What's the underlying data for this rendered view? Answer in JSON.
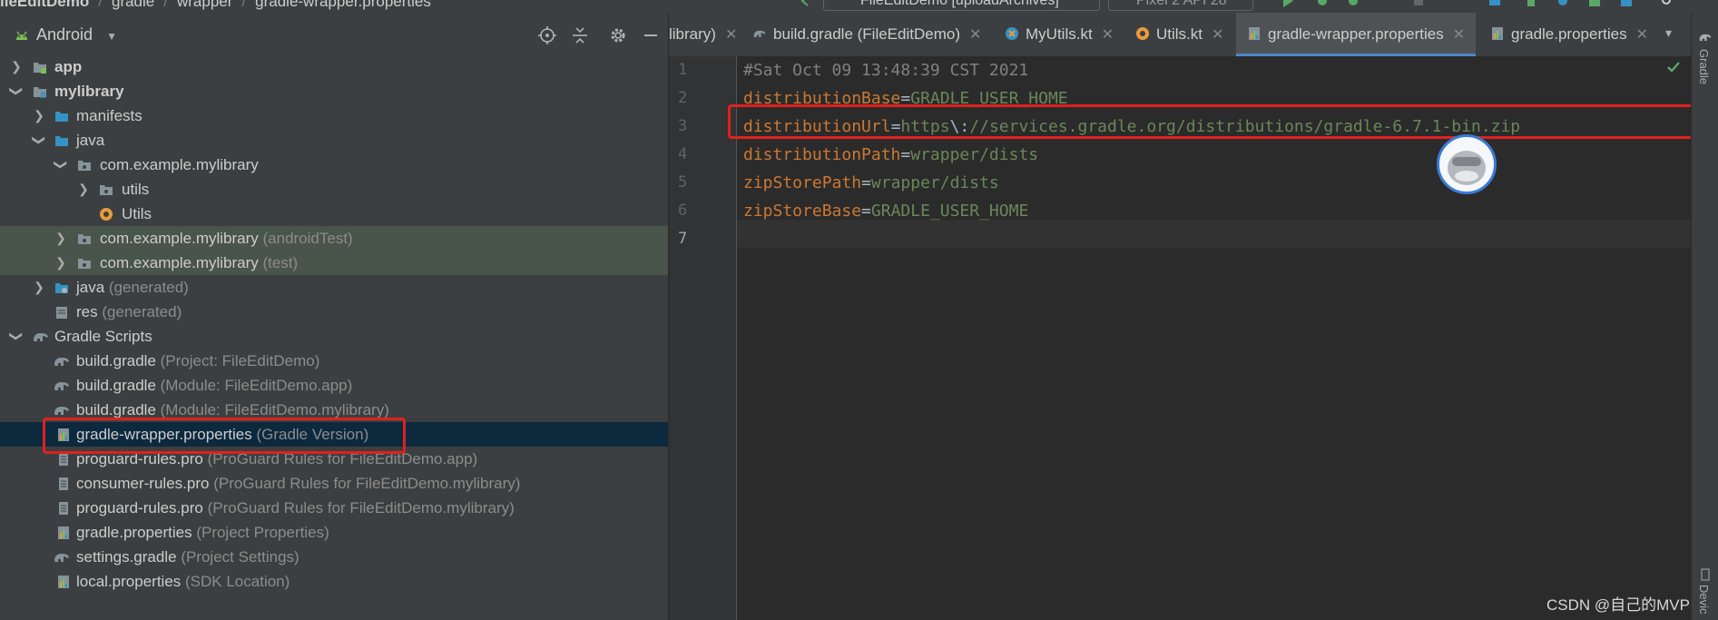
{
  "breadcrumbs": [
    "ileEditDemo",
    "gradle",
    "wrapper",
    "gradle-wrapper.properties"
  ],
  "toolbar": {
    "run_config": "FileEditDemo [uploadArchives]",
    "device": "Pixel 2 API 28"
  },
  "project_panel": {
    "view_label": "Android"
  },
  "tree": [
    {
      "label": "app",
      "sub": ""
    },
    {
      "label": "mylibrary",
      "sub": ""
    },
    {
      "label": "manifests",
      "sub": ""
    },
    {
      "label": "java",
      "sub": ""
    },
    {
      "label": "com.example.mylibrary",
      "sub": ""
    },
    {
      "label": "utils",
      "sub": ""
    },
    {
      "label": "Utils",
      "sub": ""
    },
    {
      "label": "com.example.mylibrary",
      "sub": "(androidTest)"
    },
    {
      "label": "com.example.mylibrary",
      "sub": "(test)"
    },
    {
      "label": "java",
      "sub": "(generated)"
    },
    {
      "label": "res",
      "sub": "(generated)"
    },
    {
      "label": "Gradle Scripts",
      "sub": ""
    },
    {
      "label": "build.gradle",
      "sub": "(Project: FileEditDemo)"
    },
    {
      "label": "build.gradle",
      "sub": "(Module: FileEditDemo.app)"
    },
    {
      "label": "build.gradle",
      "sub": "(Module: FileEditDemo.mylibrary)"
    },
    {
      "label": "gradle-wrapper.properties",
      "sub": "(Gradle Version)"
    },
    {
      "label": "proguard-rules.pro",
      "sub": "(ProGuard Rules for FileEditDemo.app)"
    },
    {
      "label": "consumer-rules.pro",
      "sub": "(ProGuard Rules for FileEditDemo.mylibrary)"
    },
    {
      "label": "proguard-rules.pro",
      "sub": "(ProGuard Rules for FileEditDemo.mylibrary)"
    },
    {
      "label": "gradle.properties",
      "sub": "(Project Properties)"
    },
    {
      "label": "settings.gradle",
      "sub": "(Project Settings)"
    },
    {
      "label": "local.properties",
      "sub": "(SDK Location)"
    }
  ],
  "tabs": [
    {
      "label": "library)"
    },
    {
      "label": "build.gradle (FileEditDemo)"
    },
    {
      "label": "MyUtils.kt"
    },
    {
      "label": "Utils.kt"
    },
    {
      "label": "gradle-wrapper.properties"
    },
    {
      "label": "gradle.properties"
    }
  ],
  "editor": {
    "line_numbers": [
      "1",
      "2",
      "3",
      "4",
      "5",
      "6",
      "7"
    ],
    "lines": [
      {
        "comment": "#Sat Oct 09 13:48:39 CST 2021"
      },
      {
        "key": "distributionBase",
        "eq": "=",
        "value": "GRADLE_USER_HOME"
      },
      {
        "key": "distributionUrl",
        "eq": "=",
        "value_a": "https",
        "esc": "\\:",
        "value_b": "//services.gradle.org/distributions/gradle-6.7.1-bin.zip"
      },
      {
        "key": "distributionPath",
        "eq": "=",
        "value": "wrapper/dists"
      },
      {
        "key": "zipStorePath",
        "eq": "=",
        "value": "wrapper/dists"
      },
      {
        "key": "zipStoreBase",
        "eq": "=",
        "value": "GRADLE_USER_HOME"
      }
    ]
  },
  "right_strip": {
    "gradle_label": "Gradle",
    "device_label": "Devic"
  },
  "watermark": "CSDN @自己的MVP",
  "colors": {
    "accent_red": "#e1201c",
    "selection": "#0d293e",
    "test_highlight": "#49544a"
  }
}
